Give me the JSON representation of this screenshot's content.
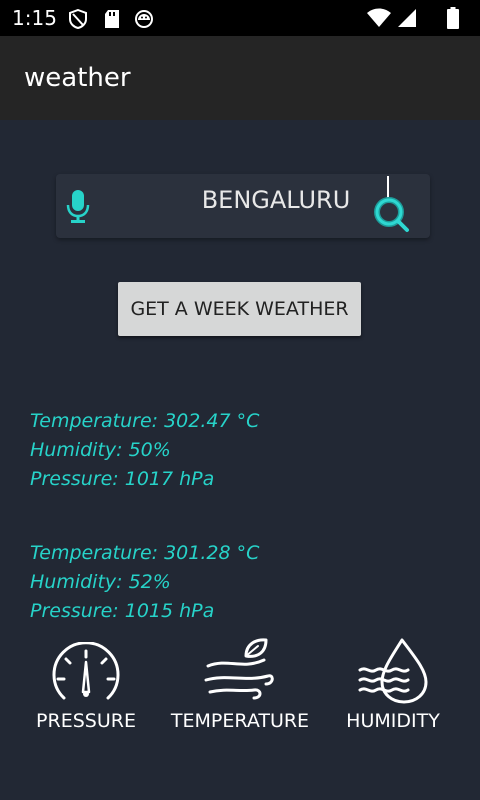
{
  "status_bar": {
    "time": "1:15"
  },
  "app_bar": {
    "title": "weather"
  },
  "search": {
    "value": "BENGALURU"
  },
  "week_button": {
    "label": "GET A WEEK WEATHER"
  },
  "readings": [
    {
      "temperature": "Temperature: 302.47 °C",
      "humidity": "Humidity: 50%",
      "pressure": "Pressure: 1017 hPa"
    },
    {
      "temperature": "Temperature: 301.28 °C",
      "humidity": "Humidity: 52%",
      "pressure": "Pressure: 1015 hPa"
    }
  ],
  "metrics": [
    {
      "label": "PRESSURE",
      "icon": "gauge-icon"
    },
    {
      "label": "TEMPERATURE",
      "icon": "wind-leaf-icon"
    },
    {
      "label": "HUMIDITY",
      "icon": "water-drop-icon"
    }
  ],
  "colors": {
    "accent": "#27d3c9",
    "background": "#222834",
    "app_bar": "#252525",
    "button": "#d6d7d7"
  }
}
